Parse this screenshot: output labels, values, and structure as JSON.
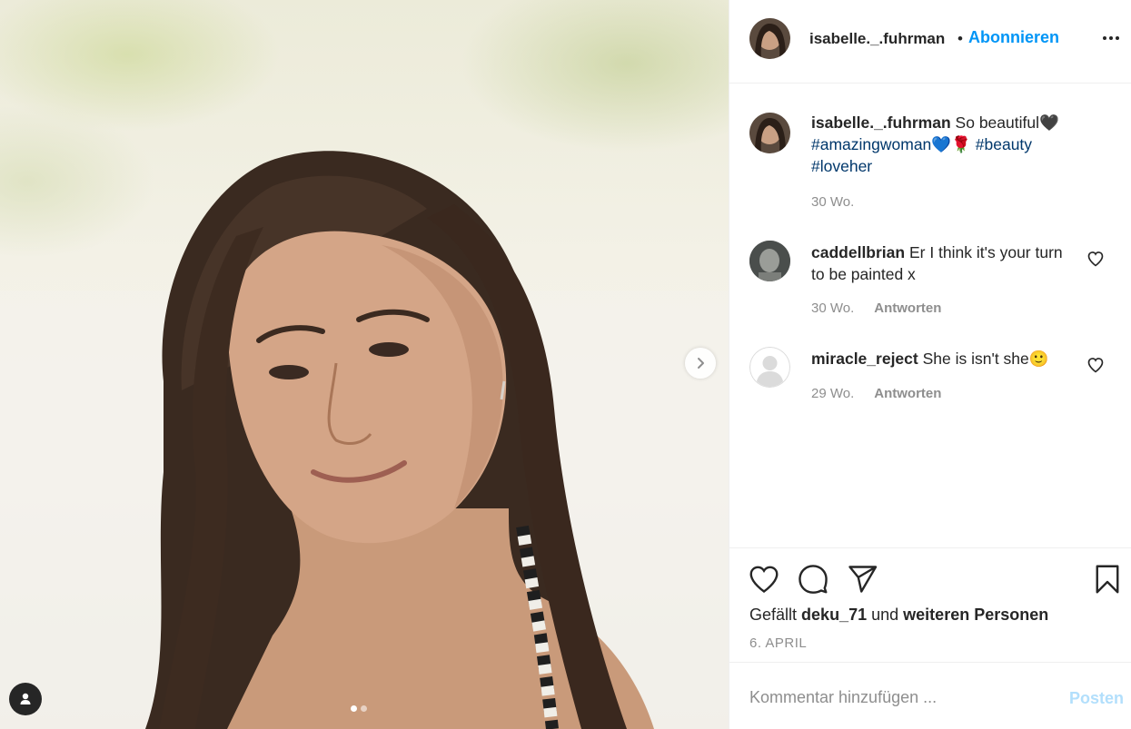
{
  "post": {
    "username": "isabelle._.fuhrman",
    "follow_label": "Abonnieren",
    "separator": "•",
    "more_icon": "more-options-icon",
    "carousel": {
      "slides": 2,
      "active": 1
    }
  },
  "caption": {
    "username": "isabelle._.fuhrman",
    "text": "So beautiful🖤",
    "hashtags": [
      "#amazingwoman",
      "#beauty",
      "#loveher"
    ],
    "emoji_after_first": "💙🌹",
    "time": "30 Wo."
  },
  "comments": [
    {
      "username": "caddellbrian",
      "text": "Er I think it's your turn to be painted x",
      "time": "30 Wo.",
      "reply_label": "Antworten"
    },
    {
      "username": "miracle_reject",
      "text": "She is isn't she🙂",
      "time": "29 Wo.",
      "reply_label": "Antworten"
    }
  ],
  "actions": {
    "likes_prefix": "Gefällt",
    "liked_by": "deku_71",
    "likes_and": "und",
    "likes_others": "weiteren Personen",
    "date": "6. APRIL"
  },
  "composer": {
    "placeholder": "Kommentar hinzufügen ...",
    "post_label": "Posten"
  },
  "colors": {
    "accent": "#0095f6",
    "hashtag": "#00376b",
    "muted": "#8e8e8e",
    "post_disabled": "#b2dffc"
  }
}
